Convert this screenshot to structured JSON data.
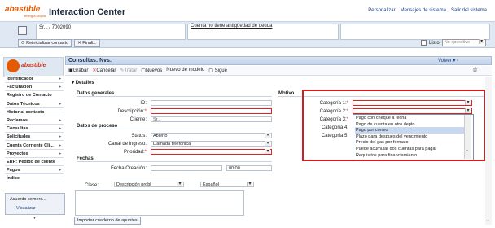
{
  "header": {
    "logo": "abastible",
    "logo_sub": "energía propia",
    "title": "Interaction Center",
    "links": [
      "Personalizar",
      "Mensajes de sistema",
      "Salir del sistema"
    ]
  },
  "context": {
    "customer": "Sr... / 7002090",
    "message": "Cuenta no tiene antigüedad de deuda",
    "reset_btn": "Reinicializar contacto",
    "finalize_btn": "Finaliz.",
    "listo_label": "Listo",
    "status_select": "No operativo"
  },
  "sidebar": {
    "logo": "abastible",
    "items": [
      {
        "label": "Identificador",
        "arrow": true
      },
      {
        "label": "Facturación",
        "arrow": true
      },
      {
        "label": "Registro de Contacto",
        "arrow": false
      },
      {
        "label": "Datos Técnicos",
        "arrow": true
      },
      {
        "label": "Historial contacto",
        "arrow": false
      },
      {
        "label": "Reclamos",
        "arrow": true
      },
      {
        "label": "Consultas",
        "arrow": true
      },
      {
        "label": "Solicitudes",
        "arrow": true
      },
      {
        "label": "Cuenta Corriente Cli...",
        "arrow": true
      },
      {
        "label": "Proyectos",
        "arrow": true
      },
      {
        "label": "ERP: Pedido de cliente",
        "arrow": false
      },
      {
        "label": "Pagos",
        "arrow": true
      },
      {
        "label": "Índice",
        "arrow": false
      }
    ],
    "fav_item": "Acuerdo comerc...",
    "fav_action": "Visualizar"
  },
  "main": {
    "title": "Consultas: Nvs.",
    "volver": "Volver",
    "toolbar": [
      "Grabar",
      "Cancelar",
      "Tratar",
      "Nuevos",
      "Nuevo de modelo",
      "Sigue"
    ],
    "detalles": "Detalles",
    "datos_generales": "Datos generales",
    "fields_general": [
      {
        "label": "ID:",
        "value": "",
        "req": false
      },
      {
        "label": "Descripción:",
        "value": "",
        "req": true
      },
      {
        "label": "Cliente:",
        "value": "Sr...",
        "req": false
      }
    ],
    "datos_proceso": "Datos de proceso",
    "fields_proceso": [
      {
        "label": "Status:",
        "value": "Abierto",
        "req": false
      },
      {
        "label": "Canal de ingreso:",
        "value": "Llamada telefónica",
        "req": false
      },
      {
        "label": "Prioridad:",
        "value": "",
        "req": true
      }
    ],
    "fechas": "Fechas",
    "fecha_creacion_label": "Fecha Creación:",
    "fecha_creacion_time": "00:00",
    "clase_label": "Clase:",
    "clase_value": "Descripción probl",
    "idioma_value": "Español",
    "import_btn": "Importar cuaderno de apuntes",
    "motivo": "Motivo",
    "categorias": [
      "Categoría 1:",
      "Categoría 2:",
      "Categoría 3:",
      "Categoría 4:",
      "Categoría 5:"
    ],
    "dropdown_options": [
      "Pago con cheque a fecha",
      "Pago de cuenta en otro depto",
      "Pago por correo",
      "Plazo para después del vencimiento",
      "Precio del gas por formato",
      "Puede acumular dos cuentas para pagar",
      "Requisitos para financiamiento"
    ],
    "dropdown_highlighted": "Pago por correo"
  },
  "colors": {
    "accent": "#d61c1c",
    "header_blue": "#c2d3e9",
    "brand": "#e35a00"
  }
}
